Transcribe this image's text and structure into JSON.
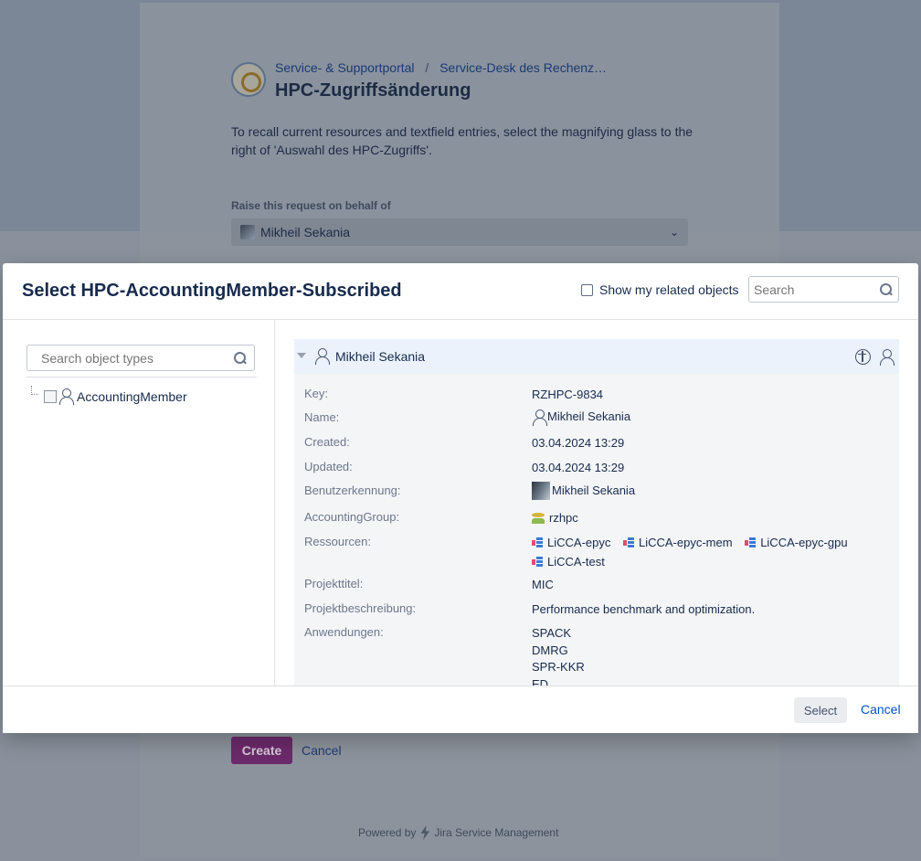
{
  "portal": {
    "breadcrumb": [
      "Service- & Supportportal",
      "Service-Desk des Rechenz…"
    ],
    "title": "HPC-Zugriffsänderung",
    "intro": "To recall current resources and textfield entries, select the magnifying glass to the right of 'Auswahl des HPC-Zugriffs'.",
    "behalf_label": "Raise this request on behalf of",
    "behalf_value": "Mikheil Sekania",
    "create_label": "Create",
    "cancel_label": "Cancel",
    "powered_prefix": "Powered by",
    "powered_product": "Jira Service Management"
  },
  "modal": {
    "title": "Select HPC-AccountingMember-Subscribed",
    "related_label": "Show my related objects",
    "search_placeholder": "Search",
    "types_search_placeholder": "Search object types",
    "tree_item": "AccountingMember",
    "object": {
      "name": "Mikheil Sekania",
      "attributes": [
        {
          "label": "Key:",
          "value": "RZHPC-9834"
        },
        {
          "label": "Name:",
          "value": "Mikheil Sekania"
        },
        {
          "label": "Created:",
          "value": "03.04.2024 13:29"
        },
        {
          "label": "Updated:",
          "value": "03.04.2024 13:29"
        },
        {
          "label": "Benutzerkennung:",
          "value": "Mikheil Sekania"
        },
        {
          "label": "AccountingGroup:",
          "value": "rzhpc"
        },
        {
          "label": "Ressourcen:",
          "values": [
            "LiCCA-epyc",
            "LiCCA-epyc-mem",
            "LiCCA-epyc-gpu",
            "LiCCA-test"
          ]
        },
        {
          "label": "Projekttitel:",
          "value": "MIC"
        },
        {
          "label": "Projektbeschreibung:",
          "value": "Performance benchmark and optimization."
        },
        {
          "label": "Anwendungen:",
          "values": [
            "SPACK",
            "DMRG",
            "SPR-KKR",
            "ED"
          ]
        }
      ]
    },
    "select_label": "Select",
    "cancel_label": "Cancel"
  }
}
